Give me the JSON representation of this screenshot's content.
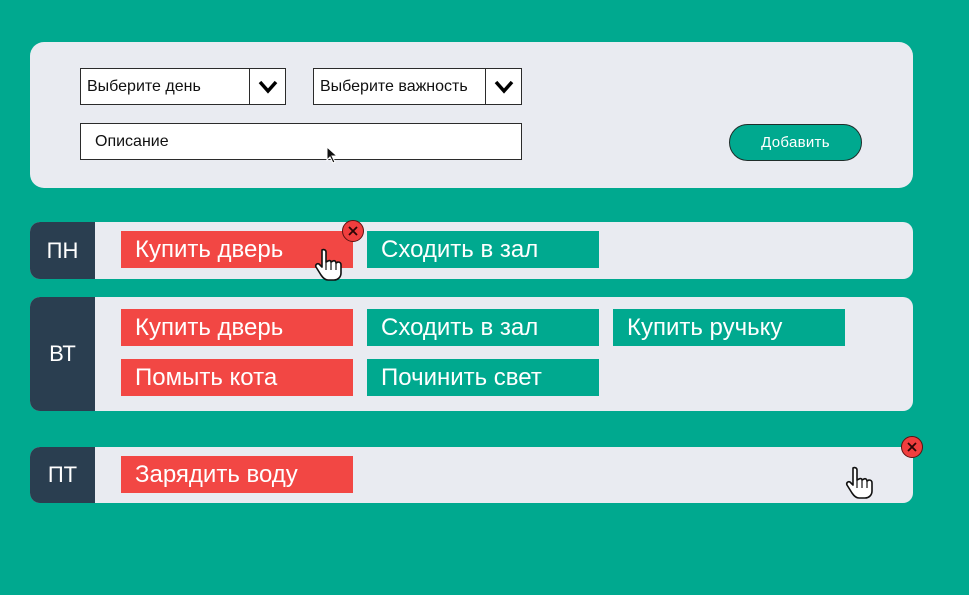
{
  "form": {
    "day_select": {
      "value": "Выберите день"
    },
    "importance_select": {
      "value": "Выберите важность"
    },
    "description": {
      "value": "Описание"
    },
    "add_button": {
      "label": "Добавить"
    }
  },
  "days": [
    {
      "label": "ПН",
      "tasks": [
        {
          "text": "Купить дверь",
          "importance": "high"
        },
        {
          "text": "Сходить в зал",
          "importance": "normal"
        }
      ]
    },
    {
      "label": "ВТ",
      "tasks": [
        {
          "text": "Купить дверь",
          "importance": "high"
        },
        {
          "text": "Сходить в зал",
          "importance": "normal"
        },
        {
          "text": "Купить ручьку",
          "importance": "normal"
        },
        {
          "text": "Помыть кота",
          "importance": "high"
        },
        {
          "text": "Починить свет",
          "importance": "normal"
        }
      ]
    },
    {
      "label": "ПТ",
      "tasks": [
        {
          "text": "Зарядить воду",
          "importance": "high"
        }
      ]
    }
  ],
  "colors": {
    "background": "#00a98f",
    "panel": "#e9ebf1",
    "day_label": "#2a3e50",
    "task_high": "#f24744",
    "task_normal": "#00a98f",
    "close": "#f03e3e"
  },
  "icons": {
    "select_arrow": "chevron-down-icon",
    "delete": "close-icon",
    "pointer": "hand-pointer-icon"
  }
}
